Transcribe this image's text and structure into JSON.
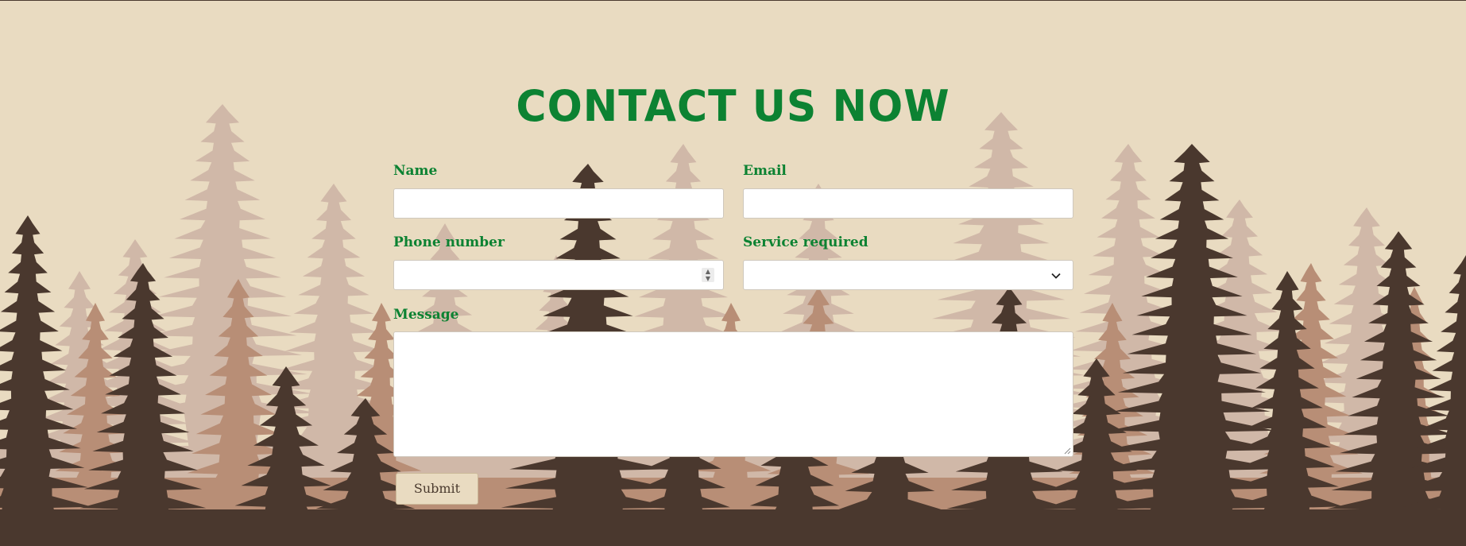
{
  "page": {
    "title": "CONTACT US NOW"
  },
  "form": {
    "name_label": "Name",
    "name_value": "",
    "email_label": "Email",
    "email_value": "",
    "phone_label": "Phone number",
    "phone_value": "",
    "service_label": "Service required",
    "service_value": "",
    "message_label": "Message",
    "message_value": "",
    "submit_label": "Submit"
  },
  "colors": {
    "background": "#e9dbc1",
    "accent_green": "#0c8232",
    "tree_dark": "#4a382e",
    "tree_mid": "#b88e76",
    "tree_light": "#d0b8a8"
  },
  "icons": {
    "spinner": "number-spinner-icon",
    "select": "chevron-down-icon",
    "resize": "resize-grip-icon"
  }
}
